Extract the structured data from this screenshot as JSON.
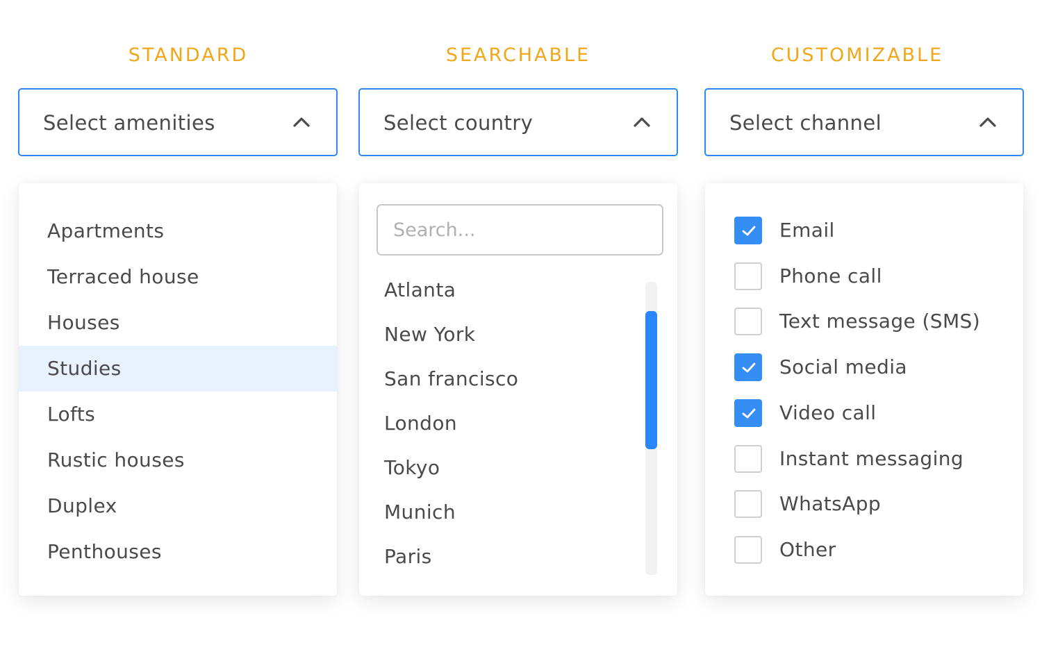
{
  "colors": {
    "accent": "#2e88f5",
    "title": "#f0a71c",
    "highlight": "#e8f2fe",
    "checkbox_on": "#348ef3"
  },
  "standard": {
    "title": "STANDARD",
    "select_label": "Select amenities",
    "icon": "chevron-up-icon",
    "options": [
      "Apartments",
      "Terraced house",
      "Houses",
      "Studies",
      "Lofts",
      "Rustic houses",
      "Duplex",
      "Penthouses"
    ],
    "highlighted": "Studies"
  },
  "searchable": {
    "title": "SEARCHABLE",
    "select_label": "Select country",
    "icon": "chevron-up-icon",
    "search_placeholder": "Search...",
    "search_value": "",
    "options": [
      "Atlanta",
      "New York",
      "San francisco",
      "London",
      "Tokyo",
      "Munich",
      "Paris"
    ],
    "scroll": {
      "thumb_start_fraction": 0.1,
      "thumb_size_fraction": 0.47
    }
  },
  "customizable": {
    "title": "CUSTOMIZABLE",
    "select_label": "Select channel",
    "icon": "chevron-up-icon",
    "options": [
      {
        "label": "Email",
        "checked": true
      },
      {
        "label": "Phone call",
        "checked": false
      },
      {
        "label": "Text message (SMS)",
        "checked": false
      },
      {
        "label": "Social media",
        "checked": true
      },
      {
        "label": "Video call",
        "checked": true
      },
      {
        "label": "Instant messaging",
        "checked": false
      },
      {
        "label": "WhatsApp",
        "checked": false
      },
      {
        "label": "Other",
        "checked": false
      }
    ]
  }
}
